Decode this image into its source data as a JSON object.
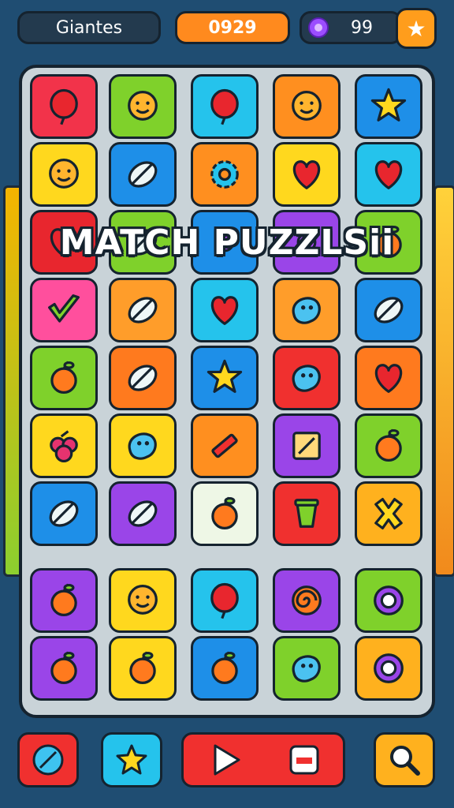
{
  "header": {
    "player_name": "Giantes",
    "score": "0929",
    "gem_count": "99",
    "star_icon": "star-icon",
    "gem_icon": "gem-icon"
  },
  "title": "MATCH PUZZLSii",
  "board": {
    "rows": [
      [
        {
          "color": "#f2334a",
          "icon": "balloon-icon"
        },
        {
          "color": "#7fd12b",
          "icon": "face-icon"
        },
        {
          "color": "#25c3ec",
          "icon": "balloon-icon"
        },
        {
          "color": "#ff8f1f",
          "icon": "face-icon"
        },
        {
          "color": "#1e8fe8",
          "icon": "star-icon"
        }
      ],
      [
        {
          "color": "#ffd81e",
          "icon": "face-icon"
        },
        {
          "color": "#1e8fe8",
          "icon": "leaf-icon"
        },
        {
          "color": "#ff8f1f",
          "icon": "gear-icon"
        },
        {
          "color": "#ffd81e",
          "icon": "heart-icon"
        },
        {
          "color": "#25c3ec",
          "icon": "heart-icon"
        }
      ],
      [
        {
          "color": "#e8262e",
          "icon": "heart-icon"
        },
        {
          "color": "#7fd12b",
          "icon": "leaf-icon"
        },
        {
          "color": "#1e8fe8",
          "icon": "dot-icon"
        },
        {
          "color": "#9a45e8",
          "icon": "dot-icon"
        },
        {
          "color": "#7fd12b",
          "icon": "fruit-icon"
        }
      ],
      [
        {
          "color": "#ff4f9d",
          "icon": "check-icon"
        },
        {
          "color": "#ff9d2a",
          "icon": "leaf-icon"
        },
        {
          "color": "#25c3ec",
          "icon": "heart-icon"
        },
        {
          "color": "#ff9d2a",
          "icon": "blob-icon"
        },
        {
          "color": "#1e8fe8",
          "icon": "leaf-icon"
        }
      ],
      [
        {
          "color": "#7fd12b",
          "icon": "fruit-icon"
        },
        {
          "color": "#ff7a1e",
          "icon": "leaf-icon"
        },
        {
          "color": "#1e8fe8",
          "icon": "star-icon"
        },
        {
          "color": "#f0302f",
          "icon": "blob-icon"
        },
        {
          "color": "#ff7a1e",
          "icon": "heart-icon"
        }
      ],
      [
        {
          "color": "#ffd81e",
          "icon": "berry-icon"
        },
        {
          "color": "#ffd81e",
          "icon": "blob-icon"
        },
        {
          "color": "#ff8f1f",
          "icon": "pencil-icon"
        },
        {
          "color": "#9a45e8",
          "icon": "note-icon"
        },
        {
          "color": "#7fd12b",
          "icon": "fruit-icon"
        }
      ],
      [
        {
          "color": "#1e8fe8",
          "icon": "leaf-icon"
        },
        {
          "color": "#9a45e8",
          "icon": "leaf-icon"
        },
        {
          "color": "#eef7e6",
          "icon": "fruit-icon"
        },
        {
          "color": "#f0302f",
          "icon": "cup-icon"
        },
        {
          "color": "#ffb11e",
          "icon": "cross-icon"
        }
      ],
      [
        {
          "color": "#9a45e8",
          "icon": "fruit-icon"
        },
        {
          "color": "#ffd81e",
          "icon": "face-icon"
        },
        {
          "color": "#25c3ec",
          "icon": "balloon-icon"
        },
        {
          "color": "#9a45e8",
          "icon": "swirl-icon"
        },
        {
          "color": "#7fd12b",
          "icon": "ring-icon"
        }
      ],
      [
        {
          "color": "#9a45e8",
          "icon": "fruit-icon"
        },
        {
          "color": "#ffd81e",
          "icon": "fruit-icon"
        },
        {
          "color": "#1e8fe8",
          "icon": "fruit-icon"
        },
        {
          "color": "#7fd12b",
          "icon": "blob-icon"
        },
        {
          "color": "#ffb11e",
          "icon": "ring-icon"
        }
      ]
    ]
  },
  "footer": {
    "buttons": [
      {
        "name": "leaf-button",
        "icon": "leaf-icon",
        "color": "#f0302f"
      },
      {
        "name": "star-button",
        "icon": "star-icon",
        "color": "#25c3ec"
      },
      {
        "name": "play-button",
        "icon": "play-icon",
        "color": "#f0302f"
      },
      {
        "name": "search-button",
        "icon": "search-icon",
        "color": "#ffb11e"
      }
    ]
  }
}
